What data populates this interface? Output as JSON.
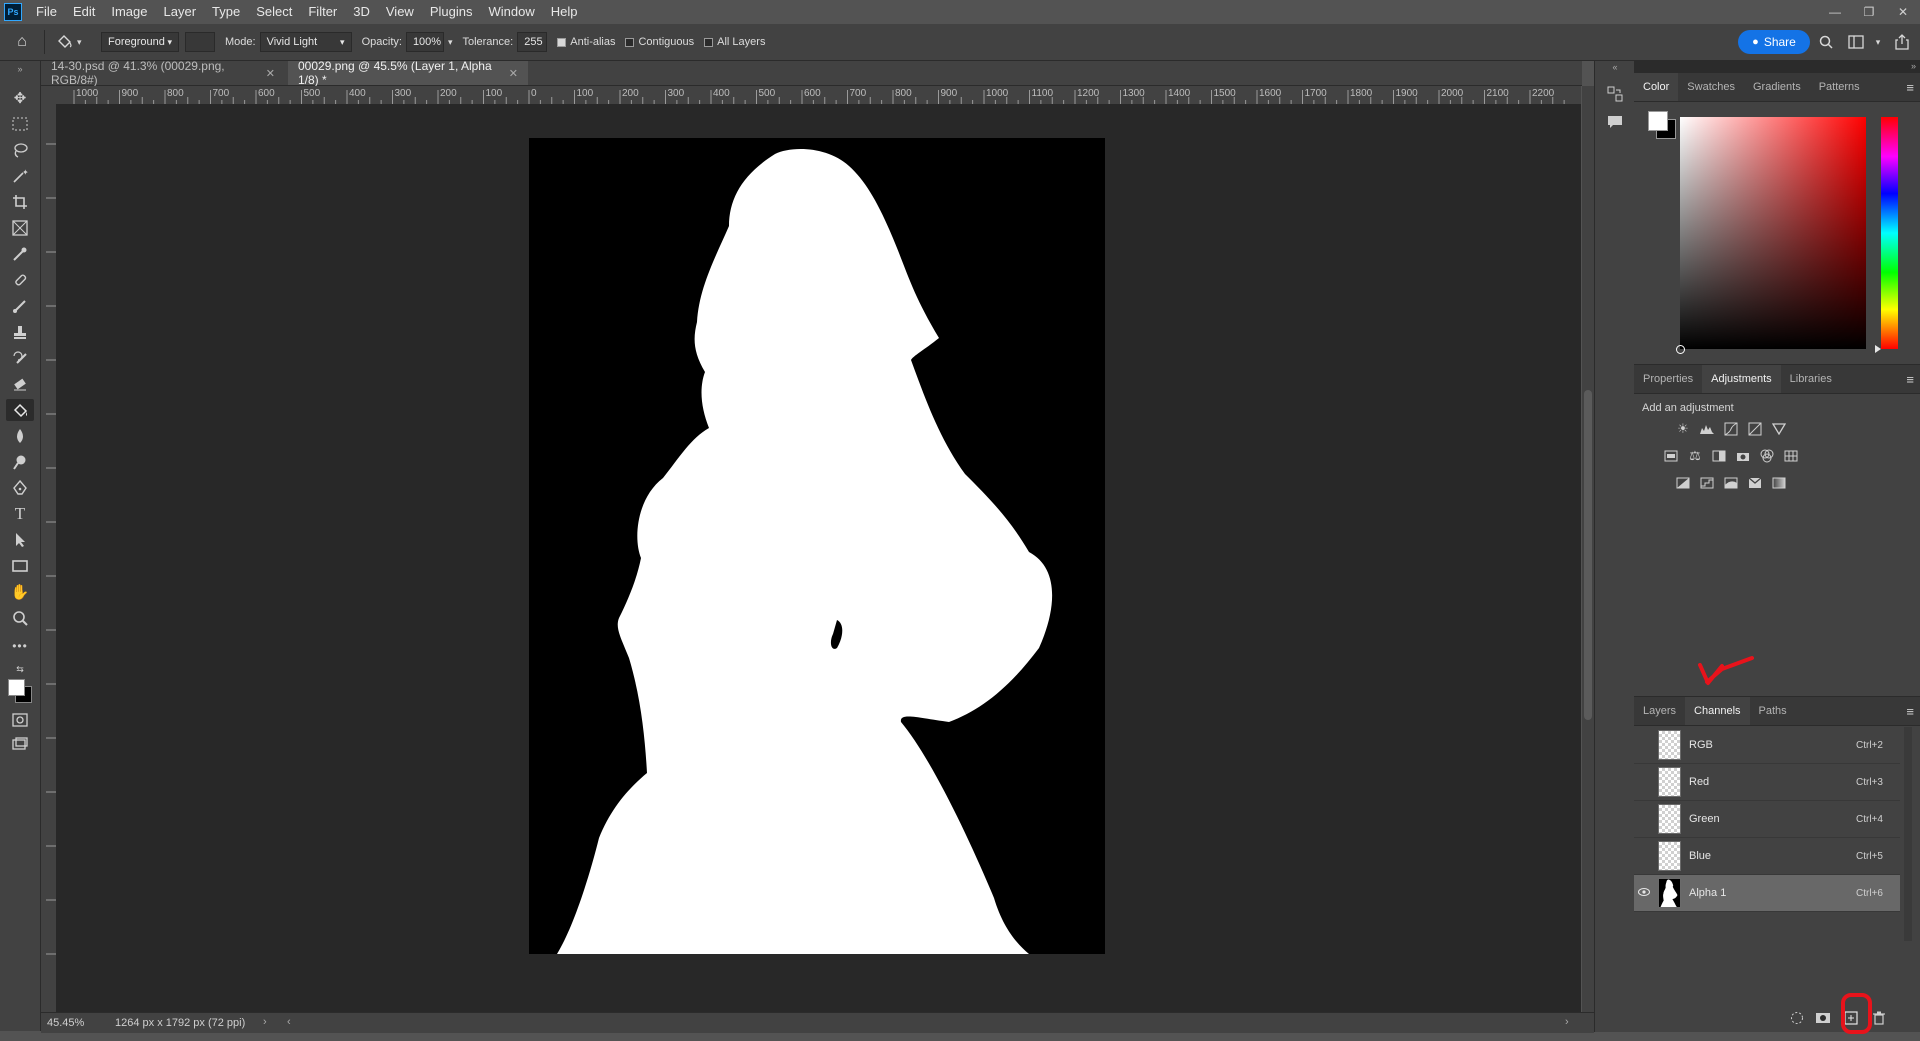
{
  "app": {
    "logo": "Ps",
    "menu": [
      "File",
      "Edit",
      "Image",
      "Layer",
      "Type",
      "Select",
      "Filter",
      "3D",
      "View",
      "Plugins",
      "Window",
      "Help"
    ]
  },
  "options": {
    "fill_source": "Foreground",
    "mode_label": "Mode:",
    "mode_value": "Vivid Light",
    "opacity_label": "Opacity:",
    "opacity_value": "100%",
    "tolerance_label": "Tolerance:",
    "tolerance_value": "255",
    "anti_alias": "Anti-alias",
    "contiguous": "Contiguous",
    "all_layers": "All Layers",
    "share": "Share"
  },
  "tabs": [
    {
      "label": "14-30.psd @ 41.3% (00029.png, RGB/8#)"
    },
    {
      "label": "00029.png @ 45.5% (Layer 1, Alpha 1/8) *"
    }
  ],
  "ruler_labels": [
    "1000",
    "900",
    "800",
    "700",
    "600",
    "500",
    "400",
    "300",
    "200",
    "100",
    "0",
    "100",
    "200",
    "300",
    "400",
    "500",
    "600",
    "700",
    "800",
    "900",
    "1000",
    "1100",
    "1200",
    "1300",
    "1400",
    "1500",
    "1600",
    "1700",
    "1800",
    "1900",
    "2000",
    "2100",
    "2200"
  ],
  "status": {
    "zoom": "45.45%",
    "doc_info": "1264 px x 1792 px (72 ppi)"
  },
  "color_panel": {
    "tabs": [
      "Color",
      "Swatches",
      "Gradients",
      "Patterns"
    ],
    "foreground": "#ffffff",
    "background": "#000000"
  },
  "adjust_panel": {
    "tabs": [
      "Properties",
      "Adjustments",
      "Libraries"
    ],
    "heading": "Add an adjustment"
  },
  "channels_panel": {
    "tabs": [
      "Layers",
      "Channels",
      "Paths"
    ],
    "rows": [
      {
        "name": "RGB",
        "shortcut": "Ctrl+2"
      },
      {
        "name": "Red",
        "shortcut": "Ctrl+3"
      },
      {
        "name": "Green",
        "shortcut": "Ctrl+4"
      },
      {
        "name": "Blue",
        "shortcut": "Ctrl+5"
      },
      {
        "name": "Alpha 1",
        "shortcut": "Ctrl+6"
      }
    ]
  },
  "annotations": {
    "color": "#e8131b"
  }
}
